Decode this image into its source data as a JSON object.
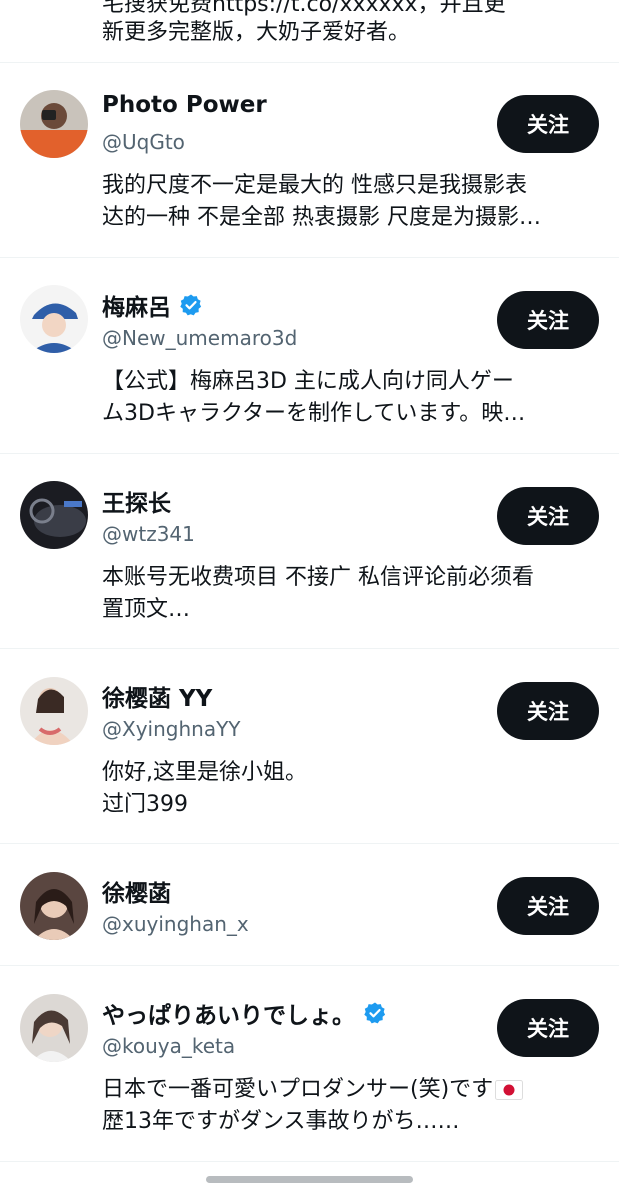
{
  "top_partial": {
    "line1": "宅搜获免费https://t.co/xxxxxx，并且更",
    "line2": "新更多完整版，大奶子爱好者。"
  },
  "follow_label": "关注",
  "accounts": [
    {
      "name": "Photo Power",
      "handle": "@UqGto",
      "verified": false,
      "bio_lines": [
        "我的尺度不一定是最大的 性感只是我摄影表",
        "达的一种 不是全部 热衷摄影 尺度是为摄影…"
      ]
    },
    {
      "name": "梅麻呂",
      "handle": "@New_umemaro3d",
      "verified": true,
      "bio_lines": [
        "【公式】梅麻呂3D 主に成人向け同人ゲー",
        "ム3Dキャラクターを制作しています。映…"
      ]
    },
    {
      "name": "王探长",
      "handle": "@wtz341",
      "verified": false,
      "bio_lines": [
        "本账号无收费项目 不接广 私信评论前必须看",
        "置顶文…"
      ]
    },
    {
      "name": "徐樱菡 YY",
      "handle": "@XyinghnaYY",
      "verified": false,
      "bio_lines": [
        "你好,这里是徐小姐。",
        "过门399"
      ]
    },
    {
      "name": "徐樱菡",
      "handle": "@xuyinghan_x",
      "verified": false,
      "bio_lines": []
    },
    {
      "name": "やっぱりあいりでしょ。",
      "handle": "@kouya_keta",
      "verified": true,
      "bio_lines": [
        "日本で一番可愛いプロダンサー(笑)です",
        "歴13年ですがダンス事故りがち……"
      ]
    }
  ],
  "colors": {
    "verified_badge": "#1d9bf0",
    "follow_button_bg": "#0f1419",
    "handle_text": "#536471",
    "divider": "#eff3f4"
  }
}
